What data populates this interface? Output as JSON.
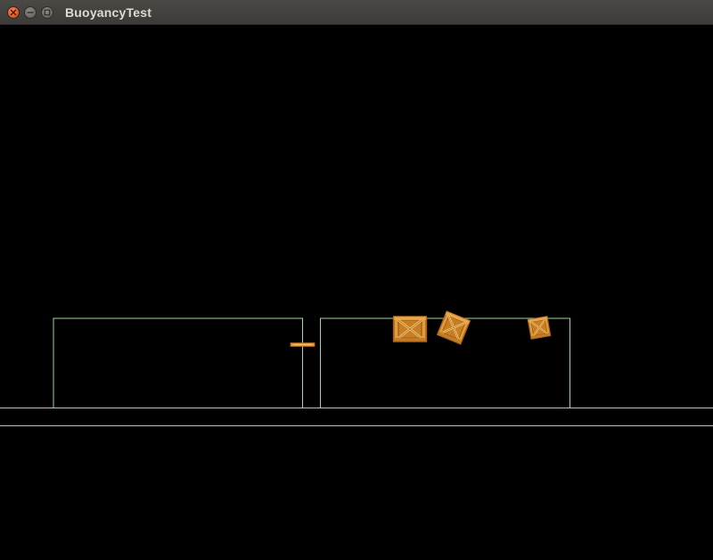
{
  "window": {
    "title": "BuoyancyTest",
    "controls": {
      "close": "close-icon",
      "minimize": "minimize-icon",
      "maximize": "maximize-icon"
    }
  },
  "scene": {
    "background_color": "#000000",
    "outline_color": "#9ed99e",
    "crate_colors": {
      "fill": "#e39a37",
      "edge": "#a8621b",
      "inner": "#c97e24",
      "brace": "#f6cf7a"
    },
    "objects": [
      "water-tank-left",
      "water-tank-right",
      "ground",
      "floating-plank",
      "crate-large",
      "crate-tilted",
      "crate-small"
    ]
  }
}
